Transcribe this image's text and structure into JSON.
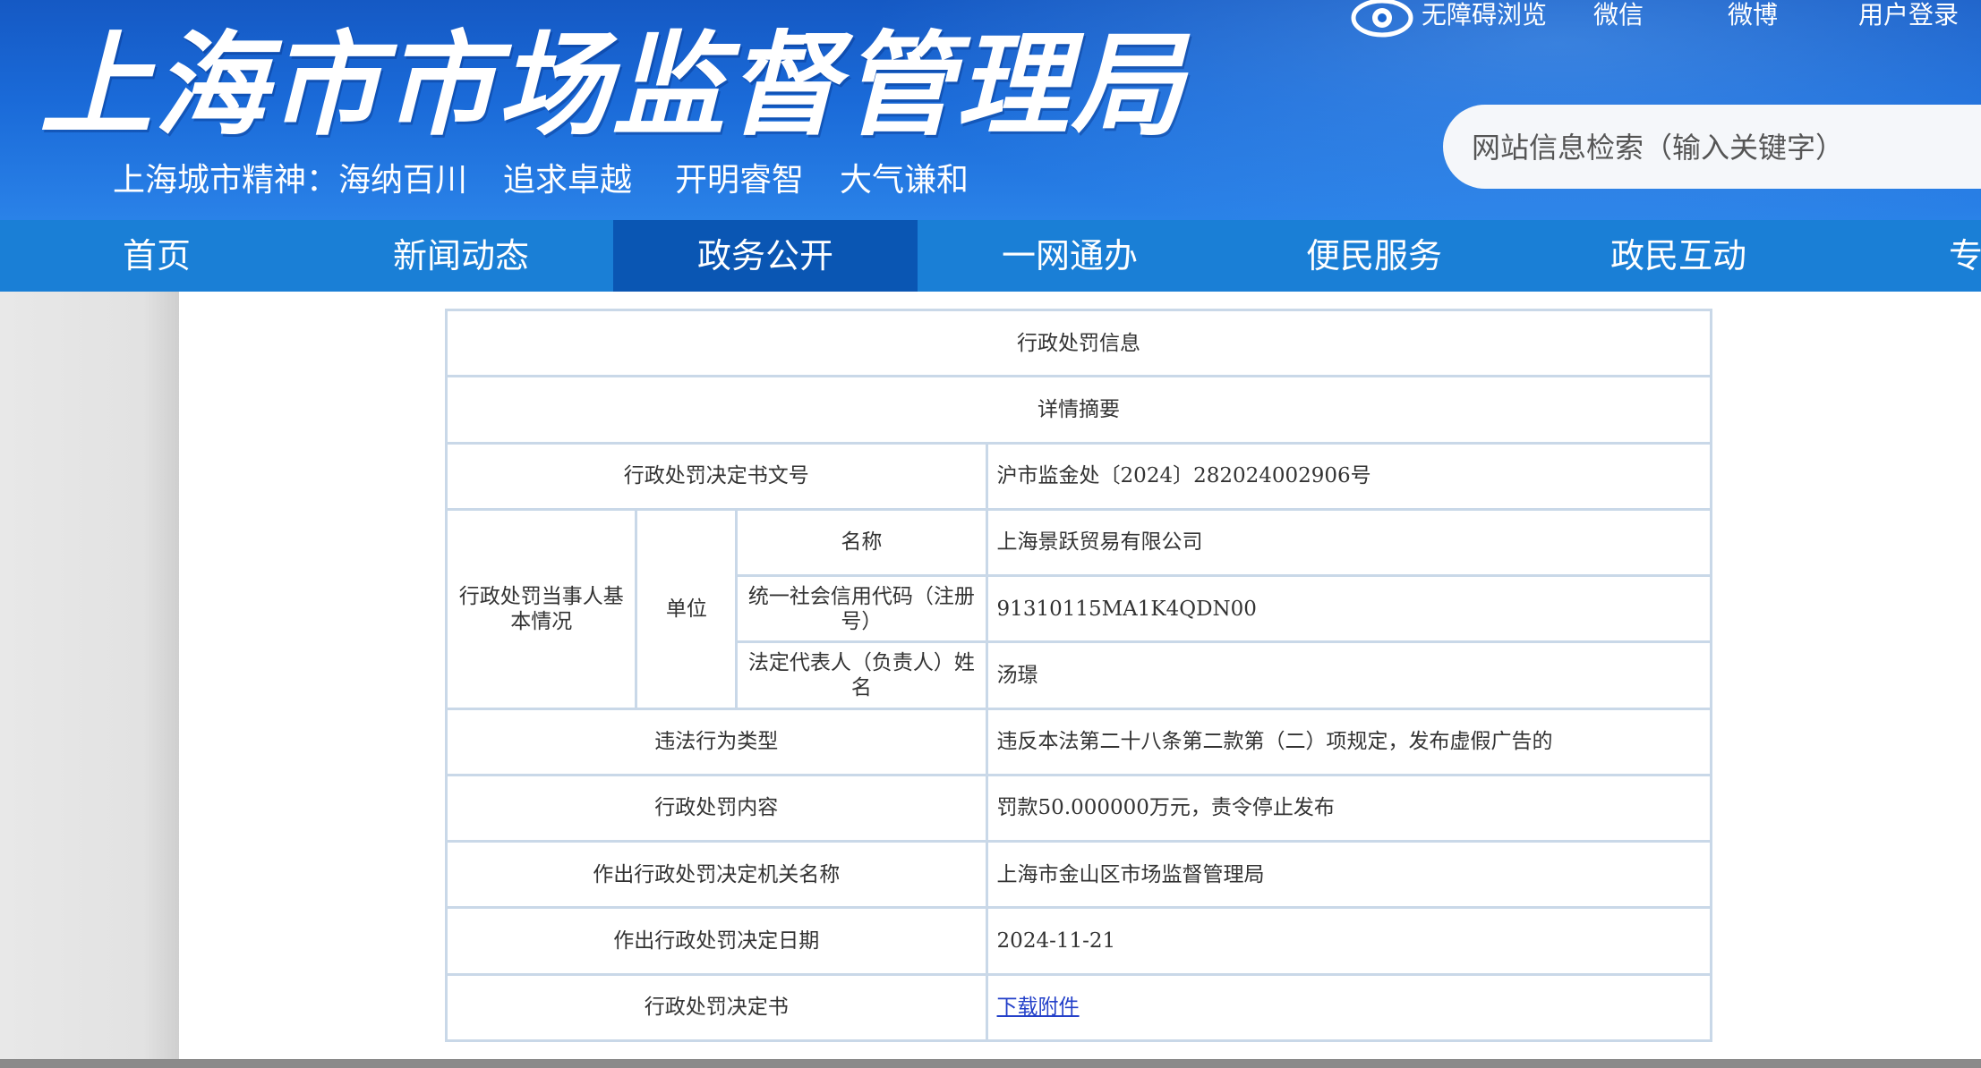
{
  "header": {
    "site_title": "上海市市场监督管理局",
    "slogan_prefix": "上海城市精神：海纳百川",
    "slogan_2": "追求卓越",
    "slogan_3": "开明睿智",
    "slogan_4": "大气谦和",
    "top_links": {
      "accessibility": "无障碍浏览",
      "wechat": "微信",
      "weibo": "微博",
      "login": "用户登录"
    },
    "search_placeholder": "网站信息检索（输入关键字）"
  },
  "nav": {
    "items": [
      "首页",
      "新闻动态",
      "政务公开",
      "一网通办",
      "便民服务",
      "政民互动",
      "专题"
    ],
    "active": "政务公开"
  },
  "table": {
    "title": "行政处罚信息",
    "subtitle": "详情摘要",
    "decision_no_label": "行政处罚决定书文号",
    "decision_no_value": "沪市监金处〔2024〕282024002906号",
    "party_label": "行政处罚当事人基本情况",
    "unit_label": "单位",
    "name_label": "名称",
    "name_value": "上海景跃贸易有限公司",
    "credit_code_label": "统一社会信用代码（注册号）",
    "credit_code_value": "91310115MA1K4QDN00",
    "legal_rep_label": "法定代表人（负责人）姓名",
    "legal_rep_value": "汤璟",
    "violation_type_label": "违法行为类型",
    "violation_type_value": "违反本法第二十八条第二款第（二）项规定，发布虚假广告的",
    "penalty_content_label": "行政处罚内容",
    "penalty_content_value": "罚款50.000000万元，责令停止发布",
    "authority_label": "作出行政处罚决定机关名称",
    "authority_value": "上海市金山区市场监督管理局",
    "date_label": "作出行政处罚决定日期",
    "date_value": "2024-11-21",
    "document_label": "行政处罚决定书",
    "document_link": "下载附件"
  },
  "icons": [
    "eye-icon"
  ],
  "colors": {
    "header_blue": "#1a6ad8",
    "nav_blue": "#1a7fd6",
    "nav_active": "#0a56b3",
    "table_border": "#c9d8e8",
    "link": "#2340c9"
  }
}
